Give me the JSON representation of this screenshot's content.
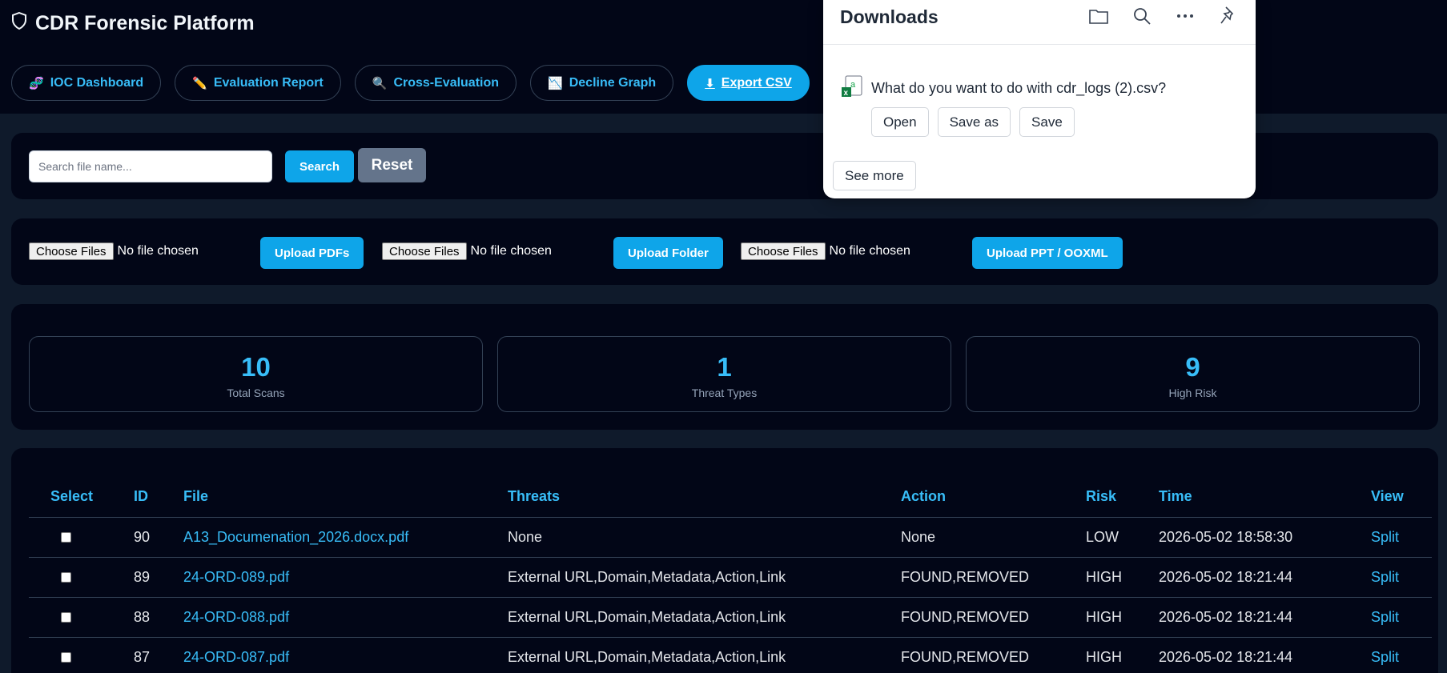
{
  "header": {
    "title": "CDR Forensic Platform",
    "nav": [
      {
        "icon": "dna",
        "glyph": "🧬",
        "label": "IOC Dashboard"
      },
      {
        "icon": "pencil",
        "glyph": "✏️",
        "label": "Evaluation Report"
      },
      {
        "icon": "magnifier",
        "glyph": "🔍",
        "label": "Cross-Evaluation"
      },
      {
        "icon": "chart-decreasing",
        "glyph": "📉",
        "label": "Decline Graph"
      },
      {
        "icon": "download-arrow",
        "glyph": "⬇",
        "label": "Export CSV"
      }
    ]
  },
  "search": {
    "placeholder": "Search file name...",
    "value": "",
    "search_label": "Search",
    "reset_label": "Reset"
  },
  "upload": {
    "choose_label": "Choose Files",
    "no_file": "No file chosen",
    "buttons": [
      "Upload PDFs",
      "Upload Folder",
      "Upload PPT / OOXML"
    ]
  },
  "stats": [
    {
      "value": "10",
      "label": "Total Scans"
    },
    {
      "value": "1",
      "label": "Threat Types"
    },
    {
      "value": "9",
      "label": "High Risk"
    }
  ],
  "table": {
    "columns": [
      "Select",
      "ID",
      "File",
      "Threats",
      "Action",
      "Risk",
      "Time",
      "View"
    ],
    "rows": [
      {
        "id": "90",
        "file": "A13_Documenation_2026.docx.pdf",
        "threats": "None",
        "action": "None",
        "risk": "LOW",
        "time": "2026-05-02 18:58:30",
        "view": "Split"
      },
      {
        "id": "89",
        "file": "24-ORD-089.pdf",
        "threats": "External URL,Domain,Metadata,Action,Link",
        "action": "FOUND,REMOVED",
        "risk": "HIGH",
        "time": "2026-05-02 18:21:44",
        "view": "Split"
      },
      {
        "id": "88",
        "file": "24-ORD-088.pdf",
        "threats": "External URL,Domain,Metadata,Action,Link",
        "action": "FOUND,REMOVED",
        "risk": "HIGH",
        "time": "2026-05-02 18:21:44",
        "view": "Split"
      },
      {
        "id": "87",
        "file": "24-ORD-087.pdf",
        "threats": "External URL,Domain,Metadata,Action,Link",
        "action": "FOUND,REMOVED",
        "risk": "HIGH",
        "time": "2026-05-02 18:21:44",
        "view": "Split"
      }
    ]
  },
  "downloads": {
    "title": "Downloads",
    "icons": [
      "folder-icon",
      "search-icon",
      "more-icon",
      "pin-icon"
    ],
    "prompt": "What do you want to do with cdr_logs (2).csv?",
    "buttons": [
      "Open",
      "Save as",
      "Save"
    ],
    "see_more": "See more"
  },
  "colors": {
    "page_bg": "#0f1a2b",
    "panel_bg": "#020617",
    "accent": "#38bdf8",
    "primary_button": "#0ea5e9",
    "reset_button": "#64748b"
  }
}
